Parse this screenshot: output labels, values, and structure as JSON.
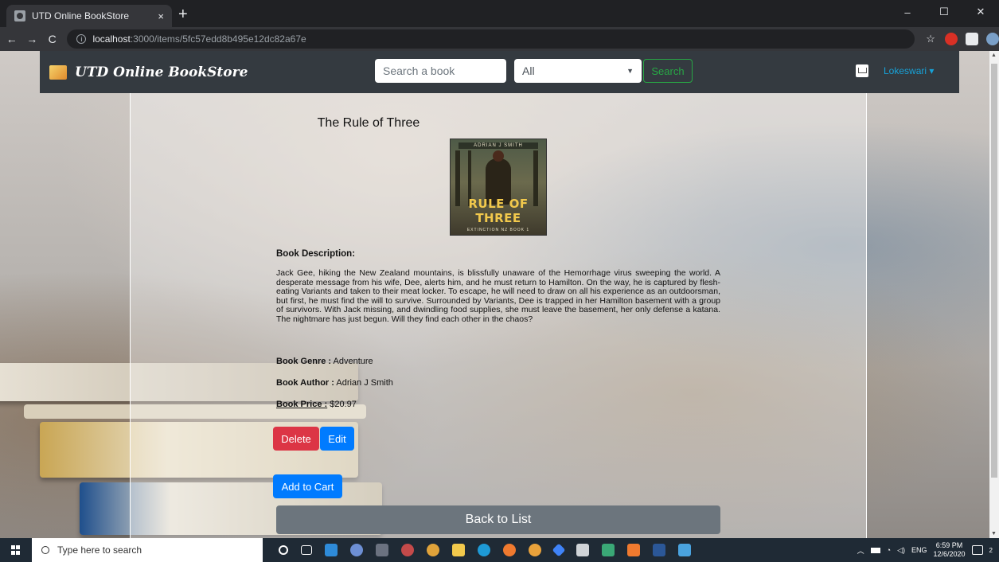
{
  "browser": {
    "tab_title": "UTD Online BookStore",
    "tab_close": "×",
    "new_tab": "+",
    "url_host": "localhost",
    "url_path": ":3000/items/5fc57edd8b495e12dc82a67e",
    "window_controls": [
      "–",
      "☐",
      "✕"
    ],
    "nav": [
      "←",
      "→",
      "C"
    ]
  },
  "navbar": {
    "brand": "UTD Online BookStore",
    "search_placeholder": "Search a book",
    "category_selected": "All",
    "search_button": "Search",
    "user": "Lokeswari"
  },
  "book": {
    "title": "The Rule of Three",
    "cover_author": "ADRIAN J SMITH",
    "cover_title": "RULE OF THREE",
    "cover_series": "EXTINCTION NZ BOOK 1",
    "description_heading": "Book Description:",
    "description": "Jack Gee, hiking the New Zealand mountains, is blissfully unaware of the Hemorrhage virus sweeping the world. A desperate message from his wife, Dee, alerts him, and he must return to Hamilton. On the way, he is captured by flesh-eating Variants and taken to their meat locker. To escape, he will need to draw on all his experience as an outdoorsman, but first, he must find the will to survive. Surrounded by Variants, Dee is trapped in her Hamilton basement with a group of survivors. With Jack missing, and dwindling food supplies, she must leave the basement, her only defense a katana. The nightmare has just begun. Will they find each other in the chaos?",
    "genre_label": "Book Genre :",
    "genre": "Adventure",
    "author_label": "Book Author :",
    "author": "Adrian J Smith",
    "price_label": "Book Price :",
    "price": "$20.97"
  },
  "actions": {
    "delete": "Delete",
    "edit": "Edit",
    "add_to_cart": "Add to Cart",
    "back": "Back to List"
  },
  "taskbar": {
    "search_placeholder": "Type here to search",
    "language": "ENG",
    "time": "6:59 PM",
    "date": "12/6/2020",
    "notifications": "2"
  }
}
